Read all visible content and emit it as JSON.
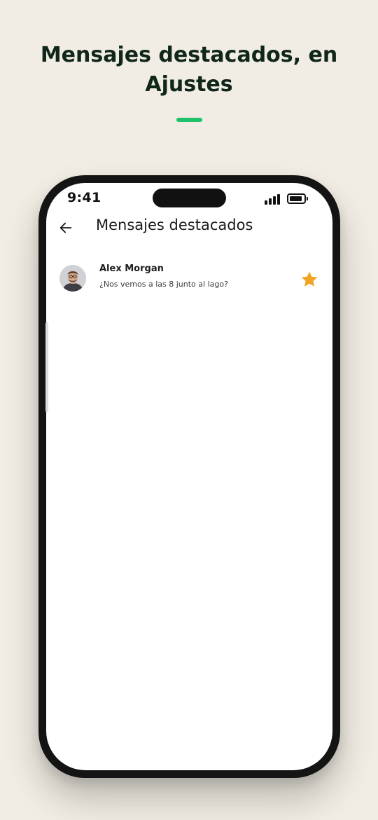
{
  "promo": {
    "title_line1": "Mensajes destacados, en",
    "title_line2": "Ajustes",
    "accent_color": "#1fc16b"
  },
  "status_bar": {
    "time": "9:41",
    "signal_icon": "cellular-signal-icon",
    "battery_icon": "battery-icon"
  },
  "header": {
    "back_icon": "arrow-left-icon",
    "title": "Mensajes destacados"
  },
  "starred_messages": [
    {
      "sender": "Alex Morgan",
      "text": "¿Nos vemos a las 8 junto al lago?",
      "avatar_icon": "user-avatar",
      "star_icon": "star-icon",
      "star_color": "#f2a322"
    }
  ]
}
